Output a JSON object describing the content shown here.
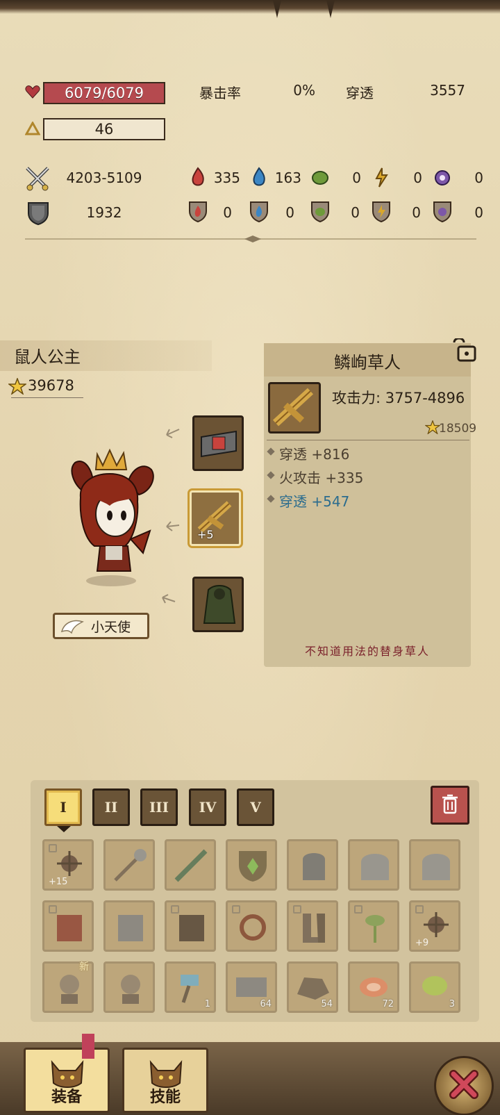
{
  "stats": {
    "hp": "6079/6079",
    "level": "46",
    "crit_label": "暴击率",
    "crit_value": "0%",
    "pierce_label": "穿透",
    "pierce_value": "3557",
    "attack": "4203-5109",
    "defense": "1932"
  },
  "elements": {
    "attack": [
      "335",
      "163",
      "0",
      "0",
      "0"
    ],
    "defense": [
      "0",
      "0",
      "0",
      "0",
      "0"
    ],
    "colors": [
      "#c9433d",
      "#3c86c4",
      "#6e9a3a",
      "#d9a72b",
      "#7d57a8"
    ]
  },
  "character": {
    "name": "鼠人公主",
    "power": "39678",
    "title_badge": "小天使",
    "equipped_slots": [
      {
        "icon": "belt-item-icon",
        "plus": ""
      },
      {
        "icon": "scarecrow-item-icon",
        "plus": "+5"
      },
      {
        "icon": "moss-armor-item-icon",
        "plus": ""
      }
    ]
  },
  "item_detail": {
    "name": "鳞峋草人",
    "attack": "攻击力: 3757-4896",
    "score": "18509",
    "props": [
      {
        "text": "穿透 +816",
        "highlight": false
      },
      {
        "text": "火攻击 +335",
        "highlight": false
      },
      {
        "text": "穿透 +547",
        "highlight": true
      }
    ],
    "description": "不知道用法的替身草人"
  },
  "inventory": {
    "tabs": [
      "I",
      "II",
      "III",
      "IV",
      "V"
    ],
    "active_tab": 0,
    "rows": [
      [
        {
          "icon": "spiked-item-icon",
          "lock": true,
          "badge": "+15"
        },
        {
          "icon": "mace-icon",
          "lock": false,
          "badge": ""
        },
        {
          "icon": "crocodile-sword-icon",
          "lock": false,
          "badge": ""
        },
        {
          "icon": "rune-shield-icon",
          "lock": false,
          "badge": ""
        },
        {
          "icon": "horned-helmet-icon",
          "lock": false,
          "badge": ""
        },
        {
          "icon": "iron-helmet-icon",
          "lock": false,
          "badge": ""
        },
        {
          "icon": "iron-helmet-icon",
          "lock": false,
          "badge": ""
        }
      ],
      [
        {
          "icon": "leather-armor-icon",
          "lock": true,
          "badge": ""
        },
        {
          "icon": "plate-armor-icon",
          "lock": false,
          "badge": ""
        },
        {
          "icon": "dark-armor-icon",
          "lock": true,
          "badge": ""
        },
        {
          "icon": "chain-item-icon",
          "lock": true,
          "badge": ""
        },
        {
          "icon": "boots-icon",
          "lock": true,
          "badge": ""
        },
        {
          "icon": "plant-item-icon",
          "lock": true,
          "badge": ""
        },
        {
          "icon": "spiked-item-icon",
          "lock": true,
          "badge": "+9"
        }
      ],
      [
        {
          "icon": "bandit-portrait-icon",
          "lock": false,
          "badge": "",
          "new": "新"
        },
        {
          "icon": "bandit-portrait-icon",
          "lock": false,
          "badge": ""
        },
        {
          "icon": "hammer-icon",
          "lock": false,
          "badge": "1"
        },
        {
          "icon": "stone-block-icon",
          "lock": false,
          "badge": "64"
        },
        {
          "icon": "ore-chunk-icon",
          "lock": false,
          "badge": "54"
        },
        {
          "icon": "meat-icon",
          "lock": false,
          "badge": "72"
        },
        {
          "icon": "herb-icon",
          "lock": false,
          "badge": "3"
        }
      ]
    ]
  },
  "bottom_nav": {
    "equipment": "装备",
    "skills": "技能"
  }
}
